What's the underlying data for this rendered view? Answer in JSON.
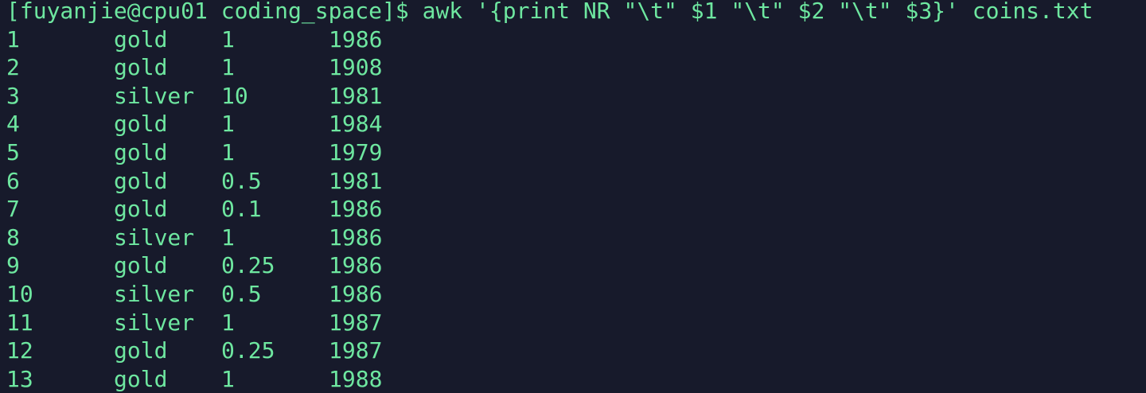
{
  "colors": {
    "background": "#171a2b",
    "text": "#6ee7a0"
  },
  "terminal": {
    "prompt": "[fuyanjie@cpu01 coding_space]$",
    "command": "awk '{print NR \"\\t\" $1 \"\\t\" $2 \"\\t\" $3}' coins.txt",
    "output": [
      [
        "1",
        "gold",
        "1",
        "1986"
      ],
      [
        "2",
        "gold",
        "1",
        "1908"
      ],
      [
        "3",
        "silver",
        "10",
        "1981"
      ],
      [
        "4",
        "gold",
        "1",
        "1984"
      ],
      [
        "5",
        "gold",
        "1",
        "1979"
      ],
      [
        "6",
        "gold",
        "0.5",
        "1981"
      ],
      [
        "7",
        "gold",
        "0.1",
        "1986"
      ],
      [
        "8",
        "silver",
        "1",
        "1986"
      ],
      [
        "9",
        "gold",
        "0.25",
        "1986"
      ],
      [
        "10",
        "silver",
        "0.5",
        "1986"
      ],
      [
        "11",
        "silver",
        "1",
        "1987"
      ],
      [
        "12",
        "gold",
        "0.25",
        "1987"
      ],
      [
        "13",
        "gold",
        "1",
        "1988"
      ]
    ]
  }
}
